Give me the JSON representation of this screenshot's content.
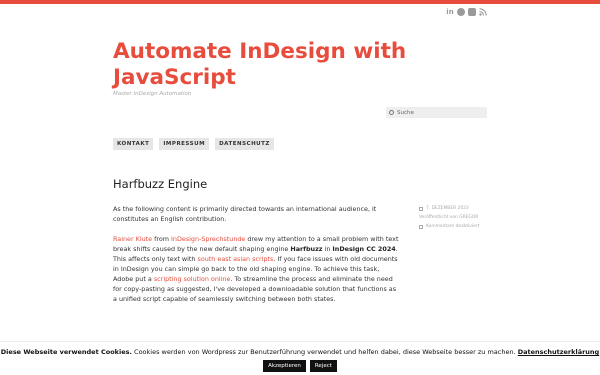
{
  "header": {
    "social_icons": [
      "linkedin-icon",
      "github-icon",
      "youtube-icon",
      "rss-icon"
    ],
    "linkedin_glyph": "in",
    "site_title": "Automate InDesign with JavaScript",
    "tagline": "Master InDesign Automation"
  },
  "search": {
    "placeholder": "Suche"
  },
  "nav": {
    "items": [
      "KONTAKT",
      "IMPRESSUM",
      "DATENSCHUTZ"
    ]
  },
  "post": {
    "title": "Harfbuzz Engine",
    "intro": "As the following content is primarily directed towards an international audience, it constitutes an English contribution.",
    "p2": {
      "link1": "Rainer Klute",
      "t1": " from ",
      "link2": "InDesign-Sprechstunde",
      "t2": " drew my attention to a small problem with text break shifts caused by the new default shaping engine ",
      "bold1": "Harfbuzz",
      "t3": " in ",
      "bold2": "InDesign CC 2024",
      "t4": ". This affects only text with ",
      "link3": "south east asian scripts",
      "t5": ". If you face issues with old documents in InDesign you can simple go back to the old shaping engine. To achieve this task, Adobe put a ",
      "link4": "scripting solution online",
      "t6": ". To streamline the process and eliminate the need for copy-pasting as suggested, I've developed a downloadable solution that functions as a unified script capable of seamlessly switching between both states."
    },
    "meta": {
      "date": "7. DEZEMBER 2023",
      "author": "Veröffentlicht von GREGOR",
      "comments": "Kommentare deaktiviert"
    }
  },
  "cookie": {
    "bold": "Diese Webseite verwendet Cookies.",
    "text": " Cookies werden von Wordpress zur Benutzerführung verwendet und helfen dabei, diese Webseite besser zu machen. ",
    "link": "Datenschutzerklärung",
    "accept": "Akzeptieren",
    "reject": "Reject"
  },
  "colors": {
    "accent": "#e74c3c",
    "text": "#333333",
    "nav_bg": "#e6e6e6"
  }
}
